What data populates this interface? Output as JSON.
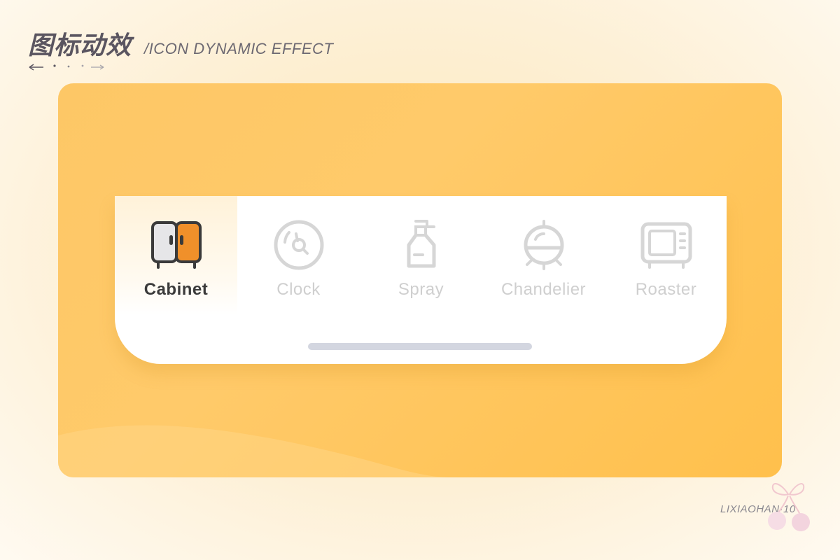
{
  "header": {
    "title_cn": "图标动效",
    "title_en": "/ICON DYNAMIC EFFECT"
  },
  "tabs": [
    {
      "label": "Cabinet",
      "icon": "cabinet-icon",
      "active": true
    },
    {
      "label": "Clock",
      "icon": "clock-icon",
      "active": false
    },
    {
      "label": "Spray",
      "icon": "spray-bottle-icon",
      "active": false
    },
    {
      "label": "Chandelier",
      "icon": "chandelier-icon",
      "active": false
    },
    {
      "label": "Roaster",
      "icon": "roaster-icon",
      "active": false
    }
  ],
  "footer": {
    "signature": "LIXIAOHAN·10"
  },
  "colors": {
    "card_top": "#fdc766",
    "card_bottom": "#ffc04c",
    "active_label": "#3b3b3b",
    "inactive": "#cfcfcf",
    "cabinet_accent": "#f0902a",
    "home_indicator": "#d3d6e0"
  }
}
